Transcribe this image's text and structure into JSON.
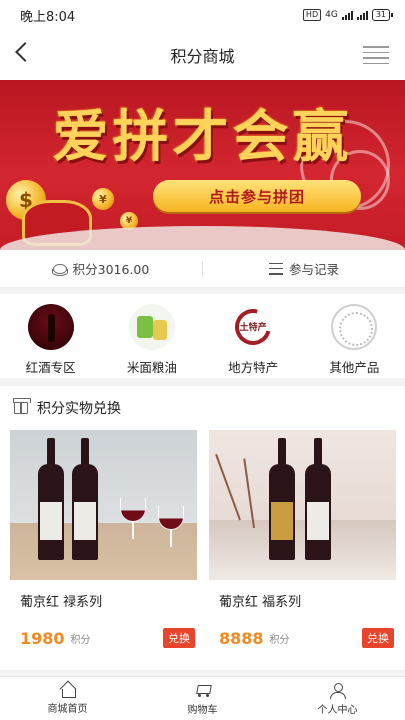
{
  "status_bar": {
    "time": "晚上8:04",
    "hd": "HD",
    "network": "4G",
    "battery": "31"
  },
  "nav": {
    "title": "积分商城"
  },
  "banner": {
    "title": "爱拼才会赢",
    "cta": "点击参与拼团"
  },
  "points_bar": {
    "points": "积分3016.00",
    "records": "参与记录"
  },
  "categories": [
    {
      "label": "红酒专区",
      "icon": "red-wine-icon"
    },
    {
      "label": "米面粮油",
      "icon": "rice-oil-icon"
    },
    {
      "label": "地方特产",
      "icon": "local-specialty-icon",
      "logo_text": "土特产"
    },
    {
      "label": "其他产品",
      "icon": "other-products-icon"
    }
  ],
  "exchange": {
    "title": "积分实物兑换",
    "products": [
      {
        "name": "葡京红 禄系列",
        "price": "1980",
        "unit": "积分",
        "button": "兑换"
      },
      {
        "name": "葡京红 福系列",
        "price": "8888",
        "unit": "积分",
        "button": "兑换"
      }
    ]
  },
  "tab_bar": {
    "items": [
      {
        "label": "商城首页",
        "icon": "home-icon"
      },
      {
        "label": "购物车",
        "icon": "cart-icon"
      },
      {
        "label": "个人中心",
        "icon": "user-icon"
      }
    ]
  },
  "colors": {
    "accent_orange": "#f08a23",
    "button_red": "#e8442b",
    "banner_red": "#c41c25",
    "banner_gold": "#ffd25a"
  }
}
